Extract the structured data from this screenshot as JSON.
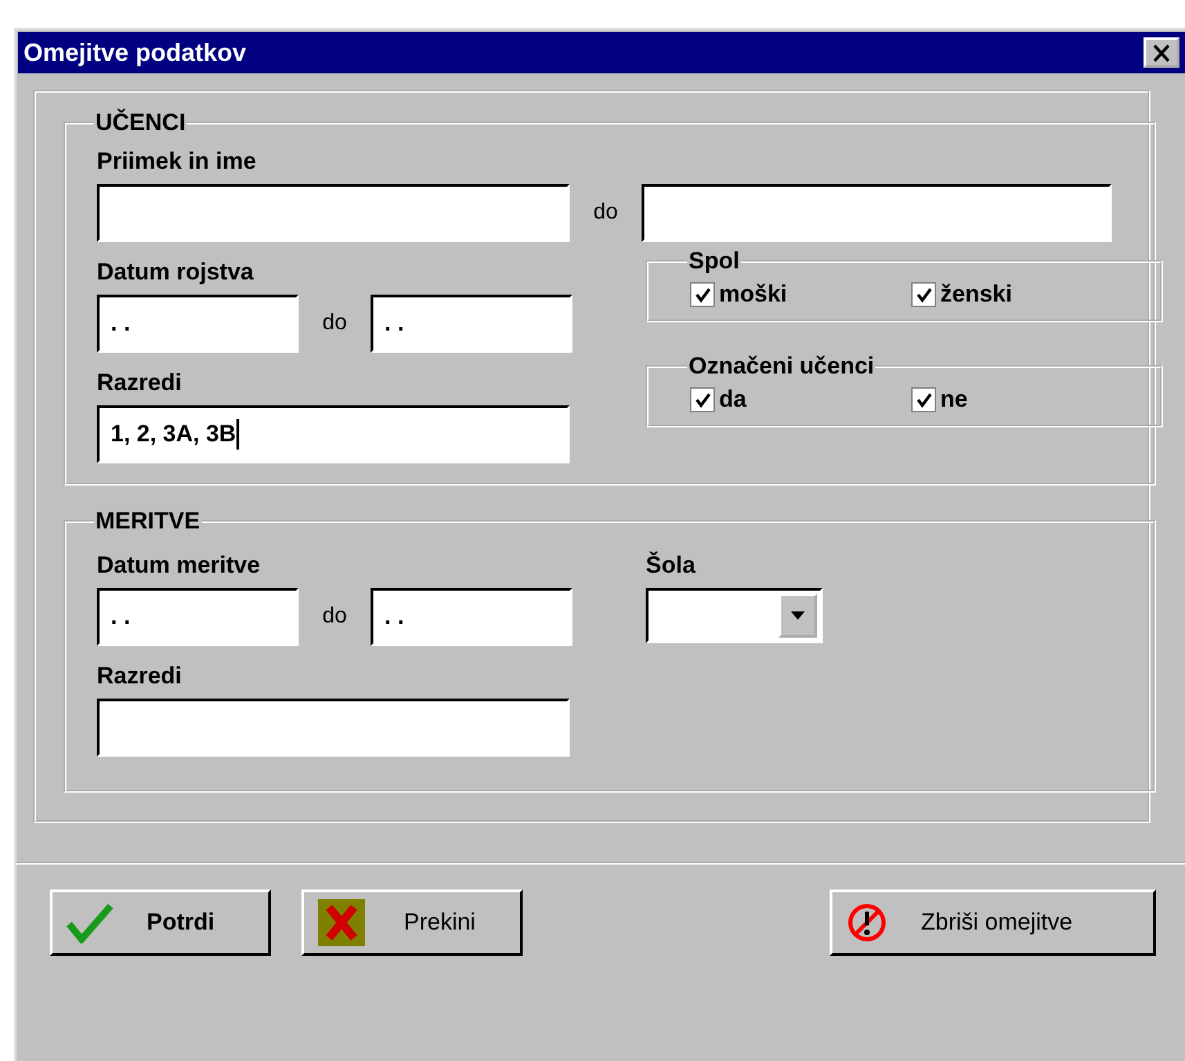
{
  "window": {
    "title": "Omejitve podatkov"
  },
  "students": {
    "legend": "UČENCI",
    "name_label": "Priimek in ime",
    "name_sep": "do",
    "birth_label": "Datum rojstva",
    "birth_from": ". .",
    "birth_sep": "do",
    "birth_to": ". .",
    "classes_label": "Razredi",
    "classes_value": "1, 2, 3A, 3B",
    "gender": {
      "legend": "Spol",
      "options": [
        {
          "label": "moški",
          "checked": true
        },
        {
          "label": "ženski",
          "checked": true
        }
      ]
    },
    "marked": {
      "legend": "Označeni učenci",
      "options": [
        {
          "label": "da",
          "checked": true
        },
        {
          "label": "ne",
          "checked": true
        }
      ]
    }
  },
  "measurements": {
    "legend": "MERITVE",
    "date_label": "Datum meritve",
    "date_from": ". .",
    "date_sep": "do",
    "date_to": ". .",
    "school_label": "Šola",
    "classes_label": "Razredi"
  },
  "buttons": [
    {
      "label": "Potrdi",
      "kind": "confirm"
    },
    {
      "label": "Prekini",
      "kind": "cancel"
    },
    {
      "label": "Zbriši omejitve",
      "kind": "clear"
    }
  ]
}
